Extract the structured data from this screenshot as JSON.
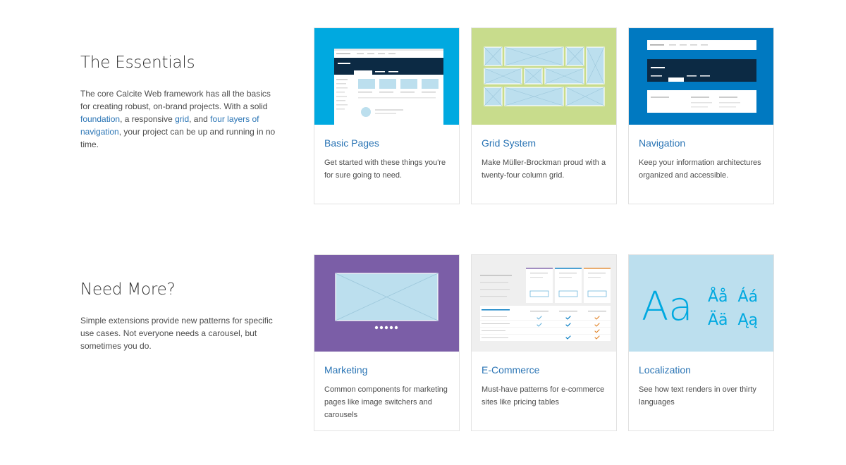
{
  "sections": [
    {
      "heading": "The Essentials",
      "text_1": "The core Calcite Web framework has all the basics for creating robust, on-brand projects. With a solid ",
      "link_1": "foundation",
      "text_2": ", a responsive ",
      "link_2": "grid",
      "text_3": ", and ",
      "link_3": "four layers of navigation",
      "text_4": ", your project can be up and running in no time.",
      "cards": [
        {
          "title": "Basic Pages",
          "description": "Get started with these things you're for sure going to need.",
          "thumb_color": "#00a9e0",
          "icon": "basic-pages-thumbnail"
        },
        {
          "title": "Grid System",
          "description": "Make Müller-Brockman proud with a twenty-four column grid.",
          "thumb_color": "#c8dc8c",
          "icon": "grid-system-thumbnail"
        },
        {
          "title": "Navigation",
          "description": "Keep your information architectures organized and accessible.",
          "thumb_color": "#0079c1",
          "icon": "navigation-thumbnail"
        }
      ]
    },
    {
      "heading": "Need More?",
      "text_1": "Simple extensions provide new patterns for specific use cases. Not everyone needs a carousel, but sometimes you do.",
      "cards": [
        {
          "title": "Marketing",
          "description": "Common components for marketing pages like image switchers and carousels",
          "thumb_color": "#7b5ea7",
          "icon": "marketing-thumbnail"
        },
        {
          "title": "E-Commerce",
          "description": "Must-have patterns for e-commerce sites like pricing tables",
          "thumb_color": "#efefef",
          "icon": "ecommerce-thumbnail"
        },
        {
          "title": "Localization",
          "description": "See how text renders in over thirty languages",
          "thumb_color": "#bcdfee",
          "icon": "localization-thumbnail",
          "glyph_large": "Aa",
          "glyph_row_1": "Åå  Áá",
          "glyph_row_2": "Ää  Ąą"
        }
      ]
    }
  ],
  "colors": {
    "link": "#2b75b5",
    "heading": "#323232",
    "body_text": "#4c4c4c",
    "card_border": "#e2e2e2"
  }
}
